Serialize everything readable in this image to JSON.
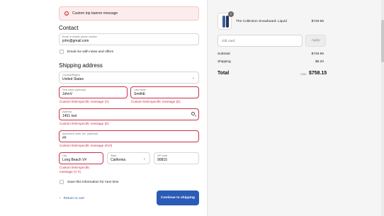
{
  "banner": {
    "icon": "error-circle-icon",
    "text": "Custom top banner message"
  },
  "contact": {
    "heading": "Contact",
    "email": {
      "label": "Email or mobile phone number",
      "value": "john@gmail.com"
    },
    "newsletter_label": "Email me with news and offers"
  },
  "shipping": {
    "heading": "Shipping address",
    "country": {
      "label": "Country/Region",
      "value": "United States"
    },
    "first_name": {
      "label": "First name (optional)",
      "value": "JohnV",
      "error": "Custom field-specific message (V)"
    },
    "last_name": {
      "label": "Last name",
      "value": "SmithE",
      "error": "Custom field-specific message (E)"
    },
    "address": {
      "label": "Address",
      "value": "1451 lost",
      "error": "Custom field-specific message (E)"
    },
    "apartment": {
      "label": "Apartment, suite, etc. (optional)",
      "value": "##",
      "error": "Custom field-specific message (#1#)"
    },
    "city": {
      "label": "City",
      "value": "Long Beach V#",
      "error": "Custom field-specific message (V #)"
    },
    "state": {
      "label": "State",
      "value": "California"
    },
    "zip": {
      "label": "ZIP code",
      "value": "90815"
    },
    "save_label": "Save this information for next time"
  },
  "footer": {
    "back_label": "Return to cart",
    "continue_label": "Continue to shipping"
  },
  "summary": {
    "product": {
      "name": "The Collection Snowboard: Liquid",
      "price": "$749.95",
      "qty": "1"
    },
    "gift_placeholder": "Gift card",
    "apply_label": "Apply",
    "subtotal_label": "Subtotal",
    "subtotal_value": "$749.95",
    "shipping_label": "Shipping",
    "shipping_value": "$8.20",
    "total_label": "Total",
    "total_currency": "CAD",
    "total_value": "$758.15"
  },
  "colors": {
    "accent": "#2a5bb7",
    "error": "#c8304a",
    "sidebar_bg": "#f5f5f5"
  }
}
